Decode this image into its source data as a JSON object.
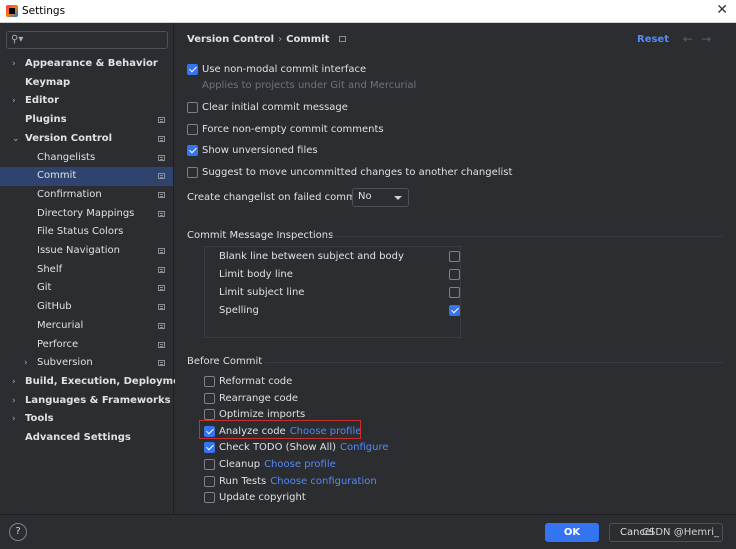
{
  "window": {
    "title": "Settings"
  },
  "search": {
    "placeholder": ""
  },
  "sidebar": {
    "items": [
      {
        "label": "Appearance & Behavior",
        "bold": true,
        "chevron": "right",
        "level": 0,
        "project": false
      },
      {
        "label": "Keymap",
        "bold": true,
        "chevron": "",
        "level": 0,
        "project": false
      },
      {
        "label": "Editor",
        "bold": true,
        "chevron": "right",
        "level": 0,
        "project": false
      },
      {
        "label": "Plugins",
        "bold": true,
        "chevron": "",
        "level": 0,
        "project": true
      },
      {
        "label": "Version Control",
        "bold": true,
        "chevron": "down",
        "level": 0,
        "project": true
      },
      {
        "label": "Changelists",
        "bold": false,
        "chevron": "",
        "level": 1,
        "project": true
      },
      {
        "label": "Commit",
        "bold": false,
        "chevron": "",
        "level": 1,
        "project": true,
        "selected": true
      },
      {
        "label": "Confirmation",
        "bold": false,
        "chevron": "",
        "level": 1,
        "project": true
      },
      {
        "label": "Directory Mappings",
        "bold": false,
        "chevron": "",
        "level": 1,
        "project": true
      },
      {
        "label": "File Status Colors",
        "bold": false,
        "chevron": "",
        "level": 1,
        "project": false
      },
      {
        "label": "Issue Navigation",
        "bold": false,
        "chevron": "",
        "level": 1,
        "project": true
      },
      {
        "label": "Shelf",
        "bold": false,
        "chevron": "",
        "level": 1,
        "project": true
      },
      {
        "label": "Git",
        "bold": false,
        "chevron": "",
        "level": 1,
        "project": true
      },
      {
        "label": "GitHub",
        "bold": false,
        "chevron": "",
        "level": 1,
        "project": true
      },
      {
        "label": "Mercurial",
        "bold": false,
        "chevron": "",
        "level": 1,
        "project": true
      },
      {
        "label": "Perforce",
        "bold": false,
        "chevron": "",
        "level": 1,
        "project": true
      },
      {
        "label": "Subversion",
        "bold": false,
        "chevron": "right",
        "level": 1,
        "project": true
      },
      {
        "label": "Build, Execution, Deployment",
        "bold": true,
        "chevron": "right",
        "level": 0,
        "project": false
      },
      {
        "label": "Languages & Frameworks",
        "bold": true,
        "chevron": "right",
        "level": 0,
        "project": false
      },
      {
        "label": "Tools",
        "bold": true,
        "chevron": "right",
        "level": 0,
        "project": false
      },
      {
        "label": "Advanced Settings",
        "bold": true,
        "chevron": "",
        "level": 0,
        "project": false
      }
    ]
  },
  "header": {
    "crumb1": "Version Control",
    "separator": "›",
    "crumb2": "Commit",
    "reset": "Reset",
    "back_arrow": "←",
    "forward_arrow": "→"
  },
  "commit": {
    "non_modal": {
      "label": "Use non-modal commit interface",
      "checked": true
    },
    "non_modal_hint": "Applies to projects under Git and Mercurial",
    "clear_initial": {
      "label": "Clear initial commit message",
      "checked": false
    },
    "force_non_empty": {
      "label": "Force non-empty commit comments",
      "checked": false
    },
    "show_unversioned": {
      "label": "Show unversioned files",
      "checked": true
    },
    "suggest_move": {
      "label": "Suggest to move uncommitted changes to another changelist",
      "checked": false
    },
    "create_changelist_label": "Create changelist on failed commit:",
    "create_changelist_value": "No"
  },
  "inspections": {
    "title": "Commit Message Inspections",
    "items": [
      {
        "label": "Blank line between subject and body",
        "checked": false
      },
      {
        "label": "Limit body line",
        "checked": false
      },
      {
        "label": "Limit subject line",
        "checked": false
      },
      {
        "label": "Spelling",
        "checked": true
      }
    ]
  },
  "before_commit": {
    "title": "Before Commit",
    "items": [
      {
        "label": "Reformat code",
        "checked": false,
        "link": ""
      },
      {
        "label": "Rearrange code",
        "checked": false,
        "link": ""
      },
      {
        "label": "Optimize imports",
        "checked": false,
        "link": ""
      },
      {
        "label": "Analyze code",
        "checked": true,
        "link": "Choose profile"
      },
      {
        "label": "Check TODO (Show All)",
        "checked": true,
        "link": "Configure"
      },
      {
        "label": "Cleanup",
        "checked": false,
        "link": "Choose profile"
      },
      {
        "label": "Run Tests",
        "checked": false,
        "link": "Choose configuration"
      },
      {
        "label": "Update copyright",
        "checked": false,
        "link": ""
      }
    ]
  },
  "footer": {
    "help": "?",
    "ok": "OK",
    "cancel": "Cancel",
    "watermark": "CSDN @Hemri_"
  },
  "colors": {
    "accent": "#3574f0",
    "link": "#548af7",
    "selection": "#2e436e",
    "background": "#2b2d30",
    "highlight_border": "#c9302c"
  }
}
